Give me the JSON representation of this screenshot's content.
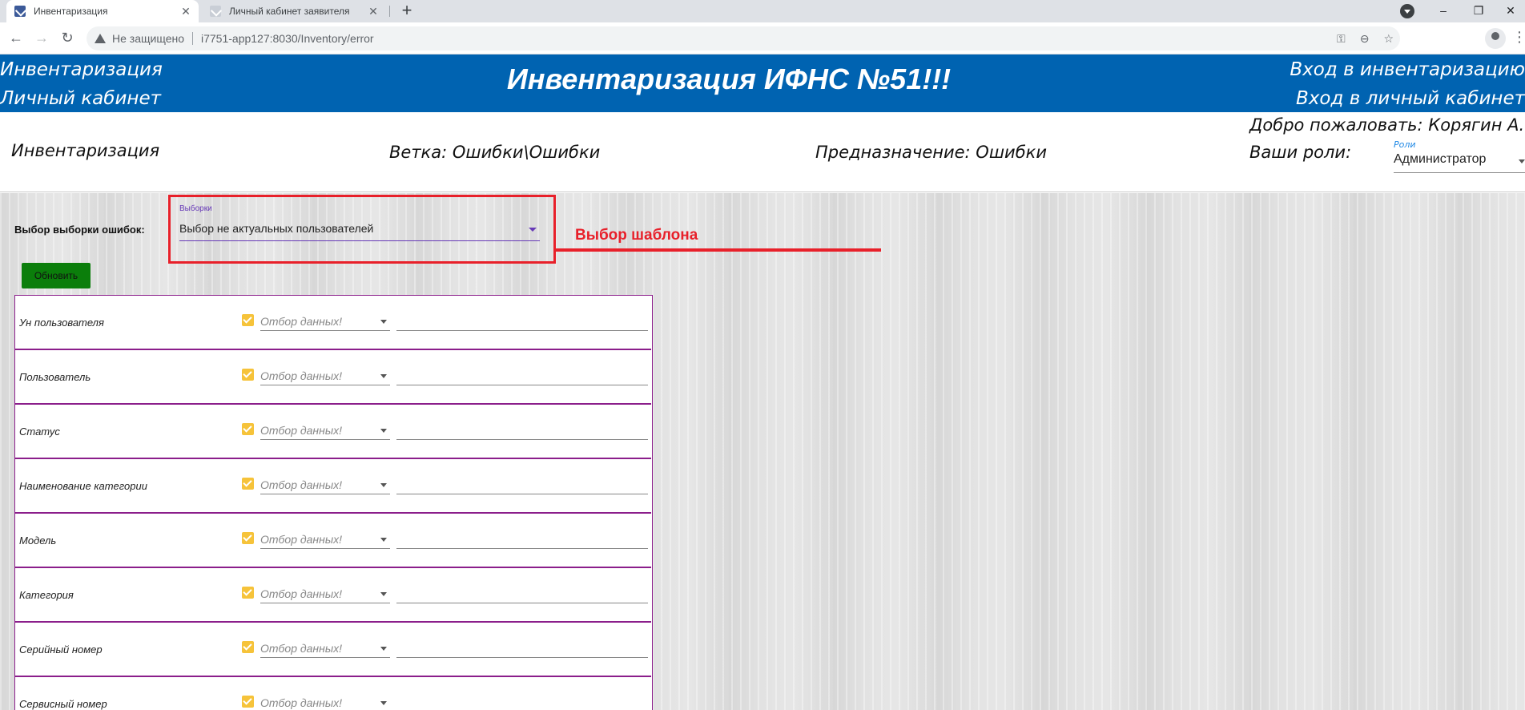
{
  "browser": {
    "tabs": [
      {
        "title": "Инвентаризация",
        "active": true
      },
      {
        "title": "Личный кабинет заявителя",
        "active": false
      }
    ],
    "security_label": "Не защищено",
    "url": "i7751-app127:8030/Inventory/error"
  },
  "header": {
    "link_inventory": "Инвентаризация",
    "link_cabinet": "Личный кабинет",
    "title": "Инвентаризация ИФНС №51!!!",
    "login_inventory": "Вход в инвентаризацию",
    "login_cabinet": "Вход в личный кабинет",
    "bg_color": "#0063b1"
  },
  "infobar": {
    "section": "Инвентаризация",
    "branch": "Ветка: Ошибки\\Ошибки",
    "purpose": "Предназначение: Ошибки",
    "welcome": "Добро пожаловать: Корягин А.С.",
    "roles_label": "Ваши роли:",
    "roles_field_label": "Роли",
    "roles_value": "Администратор"
  },
  "content": {
    "selection_label": "Выбор выборки ошибок:",
    "selection_field_label": "Выборки",
    "selection_value": "Выбор не актуальных пользователей",
    "annotation": "Выбор шаблона",
    "refresh_button": "Обновить",
    "filter_placeholder": "Отбор данных!",
    "filters": [
      {
        "label": "Ун пользователя"
      },
      {
        "label": "Пользователь"
      },
      {
        "label": "Статус"
      },
      {
        "label": "Наименование категории"
      },
      {
        "label": "Модель"
      },
      {
        "label": "Категория"
      },
      {
        "label": "Серийный номер"
      },
      {
        "label": "Сервисный номер"
      }
    ]
  },
  "colors": {
    "accent_red": "#e8202a",
    "panel_border": "#8b1e8b",
    "button_green": "#0b7e0b",
    "checkbox_yellow": "#f6c33a"
  }
}
